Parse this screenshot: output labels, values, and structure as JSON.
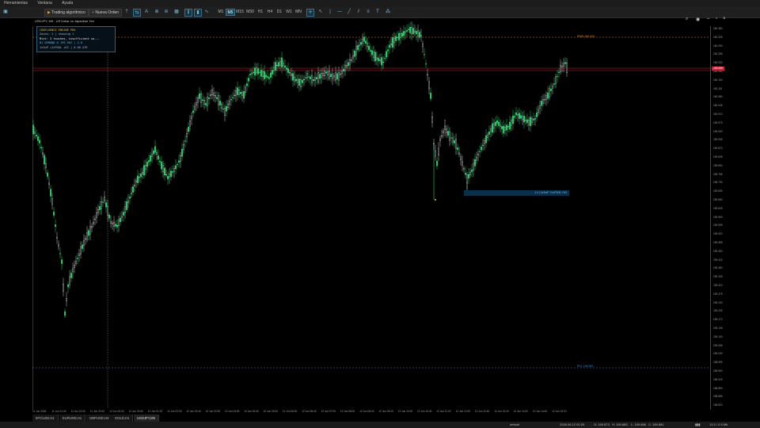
{
  "menu": {
    "items": [
      "Herramientas",
      "Ventana",
      "Ayuda"
    ]
  },
  "toolbar": {
    "algo_label": "Trading algorítmico",
    "new_order_label": "Nueva Orden",
    "timeframes": [
      "M1",
      "M5",
      "M15",
      "M30",
      "H1",
      "H4",
      "D1",
      "W1",
      "MN"
    ],
    "active_timeframe": "M5"
  },
  "chart": {
    "title": "USDJPY, M5 · US Dollar vs Japanese Yen",
    "pdh_label": "PWH 160.343",
    "pdl_label": "PDL 159.649",
    "zone_label": "1.0 | 1xSwP +1xPOOL +K2",
    "current_price": "159.959",
    "price_ticks": [
      "160.360",
      "160.325",
      "160.290",
      "160.255",
      "160.220",
      "160.185",
      "160.150",
      "160.115",
      "160.080",
      "160.045",
      "160.010",
      "159.975",
      "159.940",
      "159.905",
      "159.870",
      "159.835",
      "159.800",
      "159.765",
      "159.730",
      "159.695",
      "159.660",
      "159.625",
      "159.590",
      "159.555",
      "159.520",
      "159.485",
      "159.450",
      "159.415",
      "159.380",
      "159.345",
      "159.310",
      "159.275",
      "159.240",
      "159.205",
      "159.170",
      "159.135",
      "159.100",
      "159.065",
      "159.030",
      "158.995",
      "158.960",
      "158.925",
      "158.890",
      "158.855",
      "158.820"
    ],
    "time_ticks": [
      "11 Jun 2026",
      "11 Jun 21:40",
      "11 Jun 22:40",
      "11 Jun 23:20",
      "12 Jun 00:00",
      "12 Jun 00:40",
      "12 Jun 01:20",
      "12 Jun 02:00",
      "12 Jun 02:40",
      "12 Jun 03:20",
      "12 Jun 04:00",
      "12 Jun 04:40",
      "12 Jun 05:20",
      "12 Jun 06:00",
      "12 Jun 06:40",
      "12 Jun 07:20",
      "12 Jun 08:00",
      "12 Jun 08:40",
      "12 Jun 09:20",
      "12 Jun 10:00",
      "12 Jun 10:40",
      "12 Jun 11:20",
      "12 Jun 12:00",
      "12 Jun 12:40",
      "12 Jun 13:20",
      "12 Jun 14:00",
      "12 Jun 14:40",
      "12 Jun 15:20"
    ],
    "colors": {
      "bull": "#22d36a",
      "bear": "#c8c8c8",
      "pdh": "#e08a2a",
      "pdl": "#3f86d0",
      "price_line": "#d0203a",
      "zone": "#0a2f4a"
    }
  },
  "panel": {
    "title": "CONFLUENCE ENGINE PRO",
    "line1": "Zones: 1 | showing 1",
    "line2": "Mist: 3 touches, insufficient sa...",
    "line3": "B1 DEMAND @ 159.962 | 2.0",
    "line4": "1xSwP +1xPOOL +K2 | 0.00 ATR"
  },
  "tabs": [
    "BTCUSD,H1",
    "EURUSD,H1",
    "GBPUSD,H4",
    "GOLD,H1",
    "USDJPY,M5"
  ],
  "active_tab": "USDJPY,M5",
  "status": {
    "profile": "default",
    "datetime": "2026.06.12 00:25",
    "open": "O: 159.873",
    "high": "H: 159.883",
    "low": "L: 159.866",
    "close": "C: 159.881",
    "connection": "13.3 / 0.5 Mb"
  }
}
